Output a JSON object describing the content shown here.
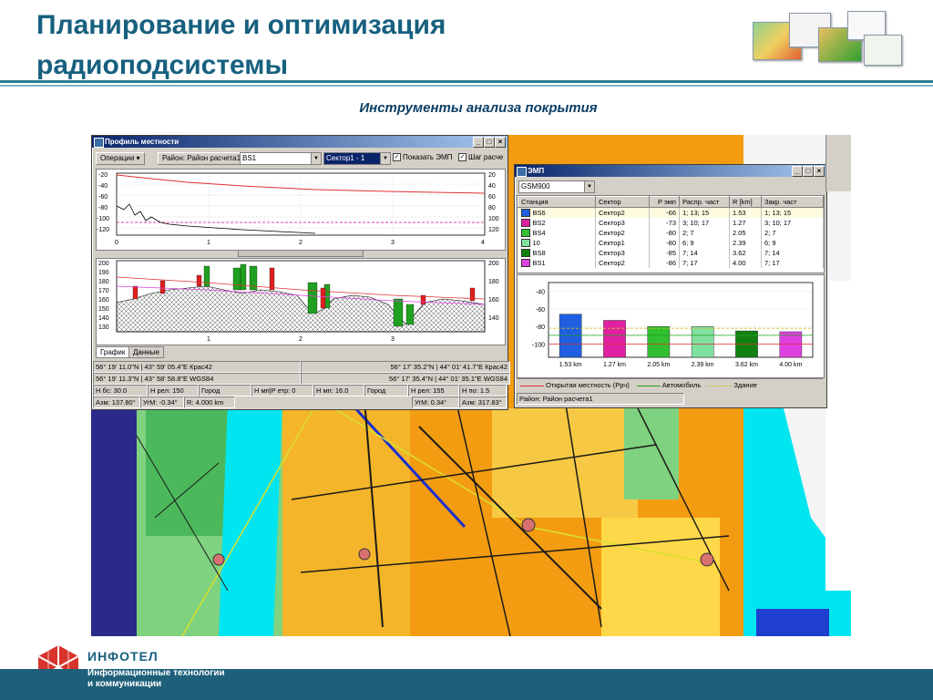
{
  "slide": {
    "title": "Планирование и оптимизация радиоподсистемы",
    "subtitle": "Инструменты анализа покрытия",
    "company": "ИНФОТЕЛ",
    "tagline_line1": "Информационные технологии",
    "tagline_line2": "и коммуникации"
  },
  "profile_window": {
    "title": "Профиль местности",
    "ops_label": "Операции",
    "region_label": "Район: Район расчета1",
    "station_value": "BS1",
    "sector_value": "Сектор1 - 1",
    "show_emp_label": "Показать ЭМП",
    "step_label": "Шаг расче",
    "upper_left_ticks": [
      "-20",
      "-40",
      "-60",
      "-80",
      "-100",
      "-120"
    ],
    "upper_right_ticks": [
      "20",
      "40",
      "60",
      "80",
      "100",
      "120"
    ],
    "upper_x_ticks": [
      "0",
      "1",
      "2",
      "3",
      "4"
    ],
    "lower_left_ticks": [
      "200",
      "190",
      "180",
      "170",
      "160",
      "150",
      "140",
      "130"
    ],
    "lower_right_ticks": [
      "200",
      "180",
      "160",
      "140"
    ],
    "lower_x_ticks": [
      "1",
      "2",
      "3"
    ],
    "tab_graph": "График",
    "tab_data": "Данные",
    "status": {
      "r1_left": "56° 19' 11.0\"N  |  43° 59' 05.4\"E Крас42",
      "r1_right": "56° 17' 35.2\"N  |  44° 01' 41.7\"E Крас42",
      "r2_left": "56° 19' 11.3\"N  |  43° 58' 58.8\"E WGS84",
      "r2_right": "56° 17' 35.4\"N  |  44° 01' 35.1\"E WGS84",
      "r3_a": "H бс: 30.0",
      "r3_b": "H рел: 150",
      "r3_c": "Город",
      "r3_d": "H мп|P етр: 0",
      "r3_e": "H мп: 16.0",
      "r3_f": "Город",
      "r3_g": "H рел: 155",
      "r3_h": "H по: 1.5",
      "r4_a": "Азм: 137.80°",
      "r4_b": "УгМ: -0.34°",
      "r4_c": "R: 4.000 km",
      "r4_d": "УгМ: 0.34°",
      "r4_e": "Азм: 317.83°"
    }
  },
  "emp_window": {
    "title": "ЭМП",
    "band_value": "GSM900",
    "columns": [
      "Станция",
      "Сектор",
      "P эмп",
      "Распр. част",
      "R [km]",
      "Закр. част"
    ],
    "rows": [
      {
        "color": "#1f5fe0",
        "station": "BS6",
        "sector": "Сектор2",
        "p": "-66",
        "freq": "1; 13; 15",
        "r": "1.53",
        "closed": "1; 13; 15"
      },
      {
        "color": "#e020a0",
        "station": "BS2",
        "sector": "Сектор3",
        "p": "-73",
        "freq": "3; 10; 17",
        "r": "1.27",
        "closed": "3; 10; 17"
      },
      {
        "color": "#30c030",
        "station": "BS4",
        "sector": "Сектор2",
        "p": "-80",
        "freq": "2; 7",
        "r": "2.05",
        "closed": "2; 7"
      },
      {
        "color": "#80e0a0",
        "station": "10",
        "sector": "Сектор1",
        "p": "-80",
        "freq": "6; 9",
        "r": "2.39",
        "closed": "6; 9"
      },
      {
        "color": "#108010",
        "station": "BS8",
        "sector": "Сектор3",
        "p": "-85",
        "freq": "7; 14",
        "r": "3.62",
        "closed": "7; 14"
      },
      {
        "color": "#e040e0",
        "station": "BS1",
        "sector": "Сектор2",
        "p": "-86",
        "freq": "7; 17",
        "r": "4.00",
        "closed": "7; 17"
      }
    ],
    "legend_terrain": "Открытая местность (Ррч)",
    "legend_car": "Автомобиль",
    "legend_building": "Здание",
    "status_region": "Район: Район расчета1"
  },
  "chart_data": {
    "type": "bar",
    "categories": [
      "1.53 km",
      "1.27 km",
      "2.05 km",
      "2.39 km",
      "3.62 km",
      "4.00 km"
    ],
    "values": [
      -66,
      -73,
      -80,
      -80,
      -85,
      -86
    ],
    "colors": [
      "#1f5fe0",
      "#e020a0",
      "#30c030",
      "#80e0a0",
      "#108010",
      "#e040e0"
    ],
    "y_ticks": [
      "-40",
      "-60",
      "-80",
      "-100"
    ],
    "ylim": [
      -115,
      -30
    ],
    "baseline": -115,
    "reference_lines": {
      "terrain": -100,
      "car": -90,
      "building": -82
    },
    "grid": true
  }
}
